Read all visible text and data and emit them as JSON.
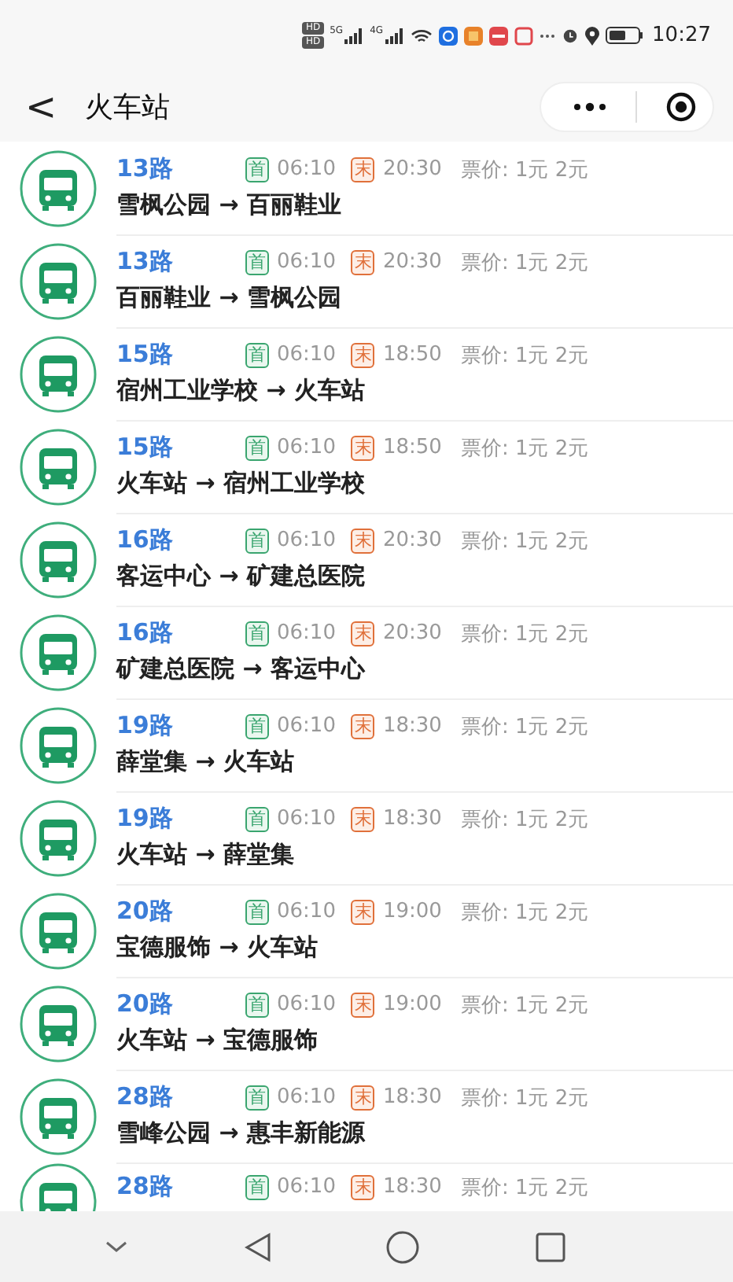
{
  "status_bar": {
    "sim_badges": [
      "HD",
      "HD"
    ],
    "networks": [
      "5G",
      "4G"
    ],
    "time": "10:27"
  },
  "header": {
    "back": "<",
    "title": "火车站"
  },
  "routes": [
    {
      "line": "13路",
      "first_label": "首",
      "first": "06:10",
      "last_label": "末",
      "last": "20:30",
      "fare": "票价: 1元 2元",
      "route": "雪枫公园 → 百丽鞋业"
    },
    {
      "line": "13路",
      "first_label": "首",
      "first": "06:10",
      "last_label": "末",
      "last": "20:30",
      "fare": "票价: 1元 2元",
      "route": "百丽鞋业 → 雪枫公园"
    },
    {
      "line": "15路",
      "first_label": "首",
      "first": "06:10",
      "last_label": "末",
      "last": "18:50",
      "fare": "票价: 1元 2元",
      "route": "宿州工业学校 → 火车站"
    },
    {
      "line": "15路",
      "first_label": "首",
      "first": "06:10",
      "last_label": "末",
      "last": "18:50",
      "fare": "票价: 1元 2元",
      "route": "火车站 → 宿州工业学校"
    },
    {
      "line": "16路",
      "first_label": "首",
      "first": "06:10",
      "last_label": "末",
      "last": "20:30",
      "fare": "票价: 1元 2元",
      "route": "客运中心 → 矿建总医院"
    },
    {
      "line": "16路",
      "first_label": "首",
      "first": "06:10",
      "last_label": "末",
      "last": "20:30",
      "fare": "票价: 1元 2元",
      "route": "矿建总医院 → 客运中心"
    },
    {
      "line": "19路",
      "first_label": "首",
      "first": "06:10",
      "last_label": "末",
      "last": "18:30",
      "fare": "票价: 1元 2元",
      "route": "薛堂集 → 火车站"
    },
    {
      "line": "19路",
      "first_label": "首",
      "first": "06:10",
      "last_label": "末",
      "last": "18:30",
      "fare": "票价: 1元 2元",
      "route": "火车站 → 薛堂集"
    },
    {
      "line": "20路",
      "first_label": "首",
      "first": "06:10",
      "last_label": "末",
      "last": "19:00",
      "fare": "票价: 1元 2元",
      "route": "宝德服饰 → 火车站"
    },
    {
      "line": "20路",
      "first_label": "首",
      "first": "06:10",
      "last_label": "末",
      "last": "19:00",
      "fare": "票价: 1元 2元",
      "route": "火车站 → 宝德服饰"
    },
    {
      "line": "28路",
      "first_label": "首",
      "first": "06:10",
      "last_label": "末",
      "last": "18:30",
      "fare": "票价: 1元 2元",
      "route": "雪峰公园 → 惠丰新能源"
    },
    {
      "line": "28路",
      "first_label": "首",
      "first": "06:10",
      "last_label": "末",
      "last": "18:30",
      "fare": "票价: 1元 2元"
    }
  ]
}
